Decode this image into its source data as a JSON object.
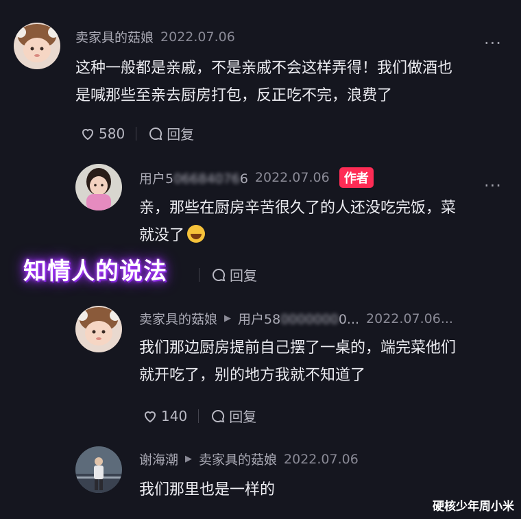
{
  "comments": [
    {
      "username": "卖家具的菇娘",
      "date": "2022.07.06",
      "more": "...",
      "text_line1": "这种一般都是亲戚，不是亲戚不会这样弄得！我们做酒也",
      "text_line2": "是喊那些至亲去厨房打包，反正吃不完，浪费了",
      "likes": "580",
      "reply_label": "回复"
    },
    {
      "username_prefix": "用户5",
      "username_blurred": "06684076",
      "username_suffix": "6",
      "date": "2022.07.06",
      "badge": "作者",
      "more": "...",
      "text_line1": "亲，那些在厨房辛苦很久了的人还没吃完饭，菜",
      "text_line2": "就没了",
      "reply_label": "回复"
    },
    {
      "username": "卖家具的菇娘",
      "reply_to_prefix": "用户58",
      "reply_to_blurred": "0000000",
      "reply_to_suffix": "0...",
      "date": "2022.07.06...",
      "text_line1": "我们那边厨房提前自己摆了一桌的，端完菜他们",
      "text_line2": "就开吃了，别的地方我就不知道了",
      "likes": "140",
      "reply_label": "回复"
    },
    {
      "username": "谢海潮",
      "reply_to": "卖家具的菇娘",
      "date": "2022.07.06",
      "text_line1": "我们那里也是一样的"
    }
  ],
  "overlay_caption": "知情人的说法",
  "watermark": "硬核少年周小米",
  "colors": {
    "background": "#15161f",
    "author_badge": "#fe2c55",
    "overlay_glow": "#9b30ff"
  }
}
